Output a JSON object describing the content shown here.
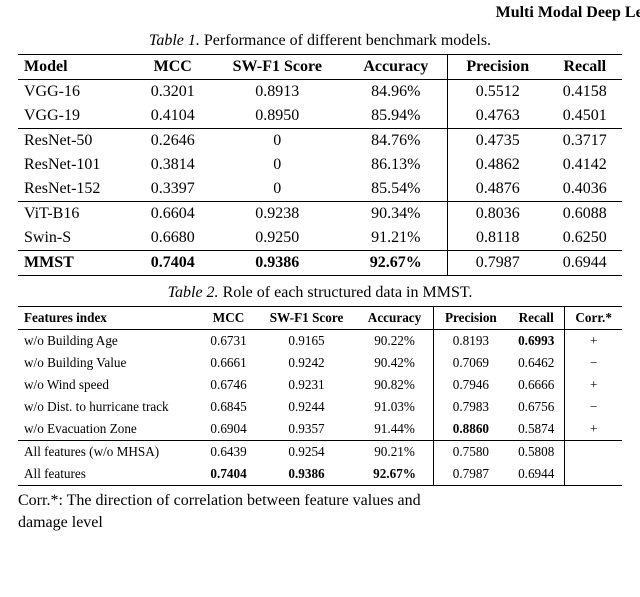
{
  "running_head": "Multi Modal Deep Learning Approach for To",
  "table1": {
    "caption_label": "Table 1.",
    "caption_text": "Performance of different benchmark models.",
    "headers": [
      "Model",
      "MCC",
      "SW-F1 Score",
      "Accuracy",
      "Precision",
      "Recall"
    ],
    "groups": [
      [
        {
          "model": "VGG-16",
          "mcc": "0.3201",
          "swf1": "0.8913",
          "acc": "84.96%",
          "prec": "0.5512",
          "rec": "0.4158"
        },
        {
          "model": "VGG-19",
          "mcc": "0.4104",
          "swf1": "0.8950",
          "acc": "85.94%",
          "prec": "0.4763",
          "rec": "0.4501"
        }
      ],
      [
        {
          "model": "ResNet-50",
          "mcc": "0.2646",
          "swf1": "0",
          "acc": "84.76%",
          "prec": "0.4735",
          "rec": "0.3717"
        },
        {
          "model": "ResNet-101",
          "mcc": "0.3814",
          "swf1": "0",
          "acc": "86.13%",
          "prec": "0.4862",
          "rec": "0.4142"
        },
        {
          "model": "ResNet-152",
          "mcc": "0.3397",
          "swf1": "0",
          "acc": "85.54%",
          "prec": "0.4876",
          "rec": "0.4036"
        }
      ],
      [
        {
          "model": "ViT-B16",
          "mcc": "0.6604",
          "swf1": "0.9238",
          "acc": "90.34%",
          "prec": "0.8036",
          "rec": "0.6088"
        },
        {
          "model": "Swin-S",
          "mcc": "0.6680",
          "swf1": "0.9250",
          "acc": "91.21%",
          "prec": "0.8118",
          "rec": "0.6250"
        }
      ]
    ],
    "final": {
      "model": "MMST",
      "mcc": "0.7404",
      "swf1": "0.9386",
      "acc": "92.67%",
      "prec": "0.7987",
      "rec": "0.6944"
    }
  },
  "table2": {
    "caption_label": "Table 2.",
    "caption_text": "Role of each structured data in MMST.",
    "headers": [
      "Features index",
      "MCC",
      "SW-F1 Score",
      "Accuracy",
      "Precision",
      "Recall",
      "Corr.*"
    ],
    "rows": [
      {
        "feat": "w/o Building Age",
        "mcc": "0.6731",
        "swf1": "0.9165",
        "acc": "90.22%",
        "prec": "0.8193",
        "rec": "0.6993",
        "rec_bold": true,
        "corr": "+"
      },
      {
        "feat": "w/o Building Value",
        "mcc": "0.6661",
        "swf1": "0.9242",
        "acc": "90.42%",
        "prec": "0.7069",
        "rec": "0.6462",
        "rec_bold": false,
        "corr": "−"
      },
      {
        "feat": "w/o Wind speed",
        "mcc": "0.6746",
        "swf1": "0.9231",
        "acc": "90.82%",
        "prec": "0.7946",
        "rec": "0.6666",
        "rec_bold": false,
        "corr": "+"
      },
      {
        "feat": "w/o Dist. to hurricane track",
        "mcc": "0.6845",
        "swf1": "0.9244",
        "acc": "91.03%",
        "prec": "0.7983",
        "rec": "0.6756",
        "rec_bold": false,
        "corr": "−"
      },
      {
        "feat": "w/o Evacuation Zone",
        "mcc": "0.6904",
        "swf1": "0.9357",
        "acc": "91.44%",
        "prec": "0.8860",
        "prec_bold": true,
        "rec": "0.5874",
        "rec_bold": false,
        "corr": "+"
      }
    ],
    "summary": [
      {
        "feat": "All features (w/o MHSA)",
        "mcc": "0.6439",
        "swf1": "0.9254",
        "acc": "90.21%",
        "prec": "0.7580",
        "rec": "0.5808",
        "corr": ""
      },
      {
        "feat": "All features",
        "mcc": "0.7404",
        "swf1": "0.9386",
        "acc": "92.67%",
        "prec": "0.7987",
        "rec": "0.6944",
        "corr": "",
        "bold_first4": true
      }
    ]
  },
  "footnote": {
    "line1": "Corr.*: The direction of correlation between feature values and",
    "line2": "damage level"
  }
}
